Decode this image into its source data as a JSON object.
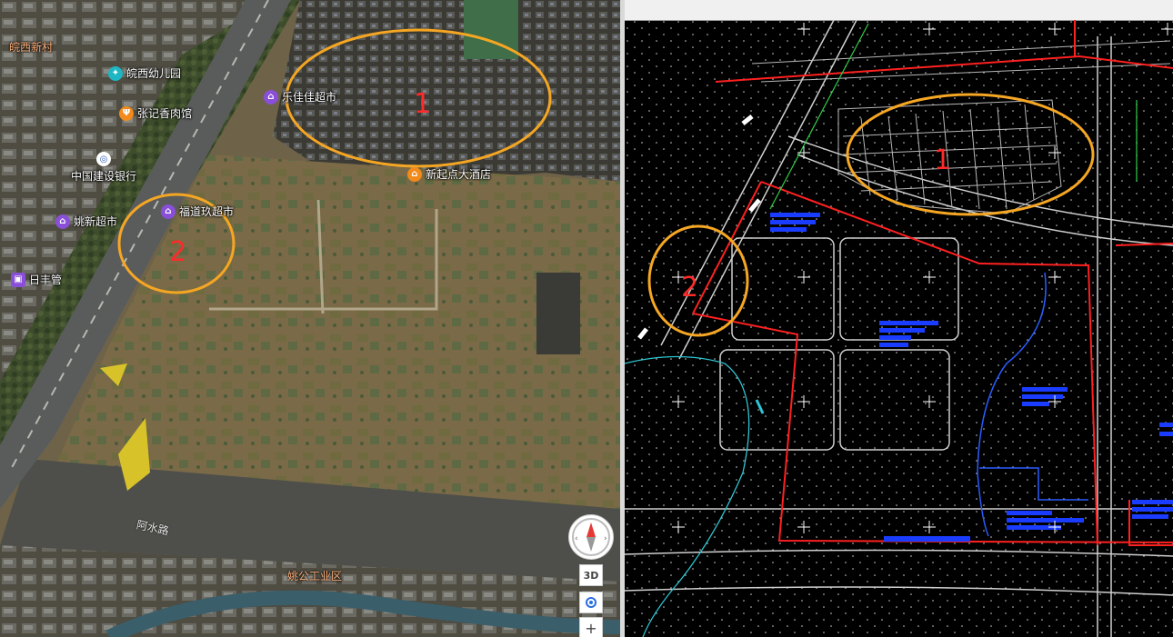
{
  "satellite_map": {
    "pois": [
      {
        "name": "皖西幼儿园",
        "icon": "school-icon",
        "color": "#1fb6c4"
      },
      {
        "name": "乐佳佳超市",
        "icon": "shopping-cart-icon",
        "color": "#8a4fd8"
      },
      {
        "name": "张记香肉馆",
        "icon": "restaurant-icon",
        "color": "#f28a1c"
      },
      {
        "name": "中国建设银行",
        "icon": "bank-icon",
        "color": "#ffffff"
      },
      {
        "name": "福道玖超市",
        "icon": "shopping-cart-icon",
        "color": "#8a4fd8"
      },
      {
        "name": "姚新超市",
        "icon": "shopping-cart-icon",
        "color": "#8a4fd8"
      },
      {
        "name": "日丰管",
        "icon": "shop-icon",
        "color": "#8a4fd8"
      },
      {
        "name": "新起点大酒店",
        "icon": "hotel-icon",
        "color": "#f28a1c"
      }
    ],
    "area_labels": {
      "village": "皖西新村",
      "industrial_zone": "姚公工业区"
    },
    "road_labels": {
      "riverside": "阿水路"
    },
    "annotations": [
      {
        "number": "1",
        "color": "#f5a623"
      },
      {
        "number": "2",
        "color": "#f5a623"
      }
    ],
    "controls": {
      "three_d": "3D",
      "zoom_in": "+",
      "locate_icon": "locate-icon",
      "compass_icon": "compass-icon"
    }
  },
  "cad_drawing": {
    "annotations": [
      {
        "number": "1",
        "color": "#f5a623"
      },
      {
        "number": "2",
        "color": "#f5a623"
      }
    ],
    "colors": {
      "background": "#000000",
      "boundary": "#ff2020",
      "linework": "#d0d0d0",
      "water": "#2a5cff",
      "river": "#2ec6d4",
      "marker": "#f5a623"
    }
  }
}
